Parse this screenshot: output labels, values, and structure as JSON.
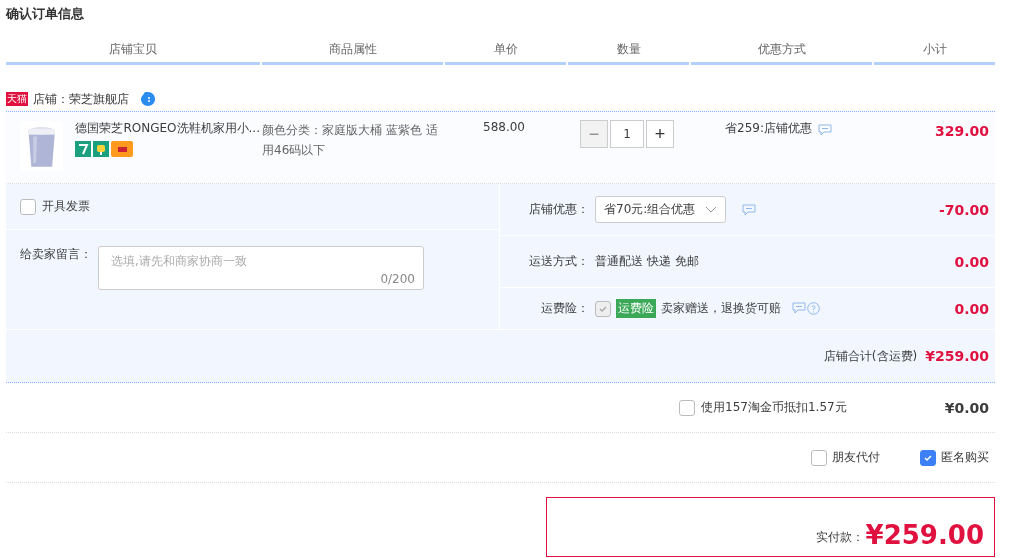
{
  "page_title": "确认订单信息",
  "columns": [
    "店铺宝贝",
    "商品属性",
    "单价",
    "数量",
    "优惠方式",
    "小计"
  ],
  "store": {
    "badge": "天猫",
    "name": "店铺：荣芝旗舰店"
  },
  "item": {
    "title": "德国荣芝RONGEO洗鞋机家用小...",
    "attributes": "颜色分类：家庭版大桶 蓝紫色 适用46码以下",
    "price": "588.00",
    "decrease": "−",
    "quantity": "1",
    "increase": "+",
    "discount": "省259:店铺优惠",
    "subtotal": "329.00"
  },
  "invoice": {
    "label": "开具发票",
    "checked": false
  },
  "message": {
    "label": "给卖家留言：",
    "placeholder": "选填,请先和商家协商一致",
    "counter": "0/200"
  },
  "store_discount": {
    "label": "店铺优惠：",
    "value": "省70元:组合优惠",
    "amount": "-70.00"
  },
  "shipping": {
    "label": "运送方式：",
    "value": "普通配送 快递 免邮",
    "amount": "0.00"
  },
  "insurance": {
    "label": "运费险：",
    "checked": true,
    "disabled": true,
    "tag": "运费险",
    "text": "卖家赠送，退换货可赔",
    "amount": "0.00"
  },
  "store_total": {
    "label": "店铺合计(含运费)",
    "amount": "¥259.00"
  },
  "coins": {
    "label": "使用157淘金币抵扣1.57元",
    "checked": false,
    "amount": "¥0.00"
  },
  "options": [
    {
      "label": "朋友代付",
      "checked": false
    },
    {
      "label": "匿名购买",
      "checked": true
    }
  ],
  "payment": {
    "label": "实付款：",
    "amount": "¥259.00"
  }
}
